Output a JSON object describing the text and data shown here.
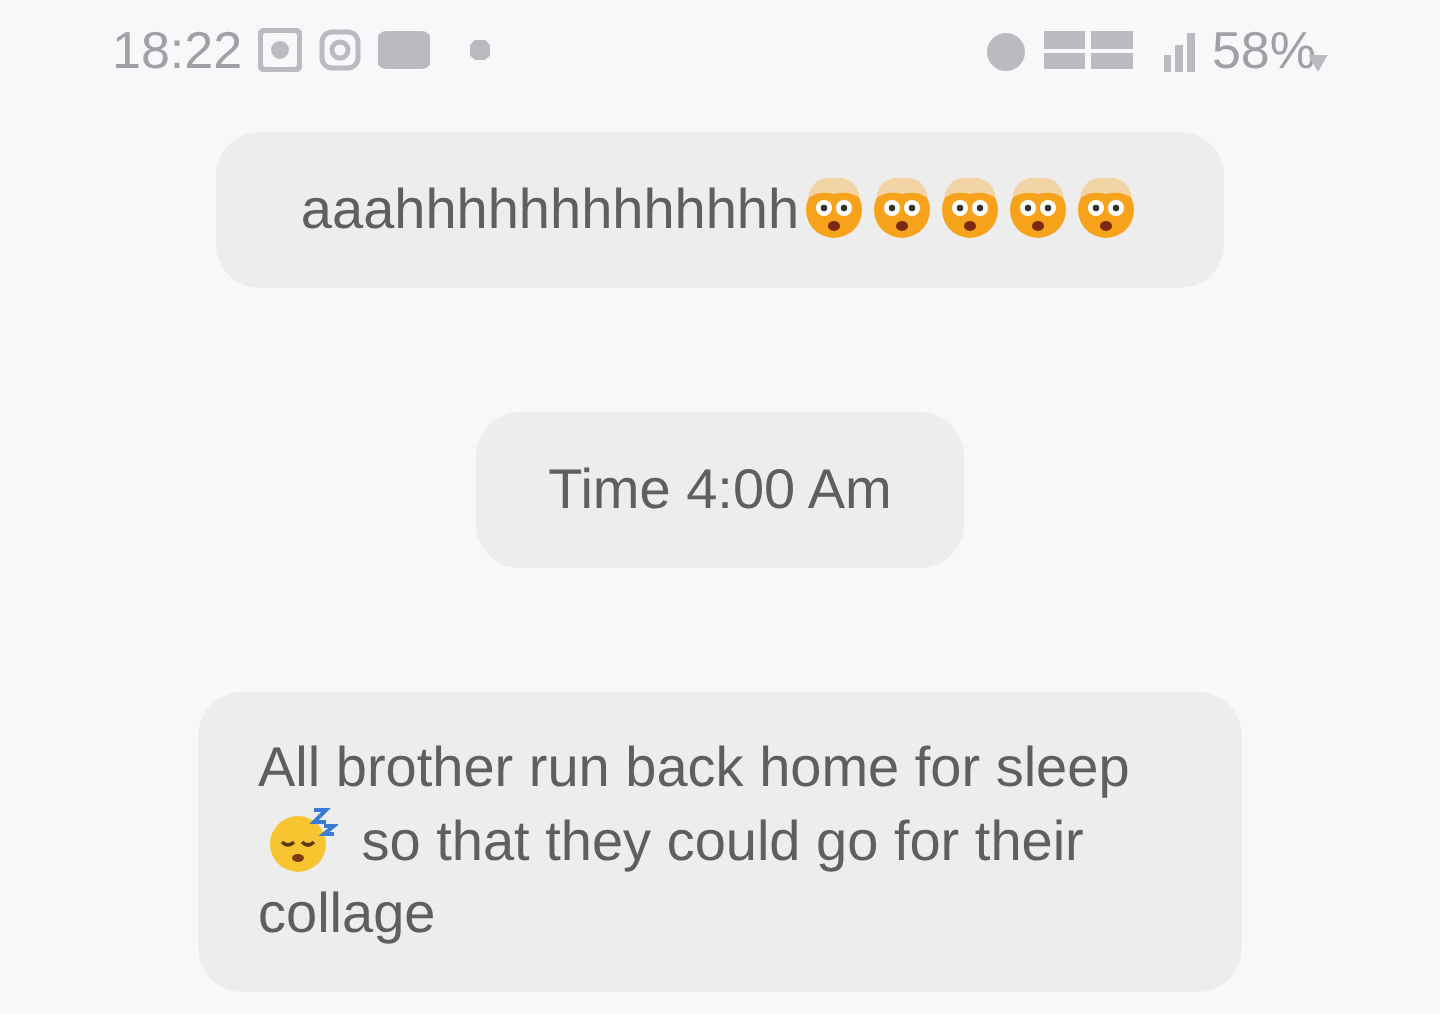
{
  "status_bar": {
    "time": "18:22",
    "battery": "58%"
  },
  "messages": [
    {
      "segments": [
        {
          "kind": "text",
          "text": "aaahhhhhhhhhhhhh"
        },
        {
          "kind": "shocked-emoji"
        },
        {
          "kind": "shocked-emoji"
        },
        {
          "kind": "shocked-emoji"
        },
        {
          "kind": "shocked-emoji"
        },
        {
          "kind": "shocked-emoji"
        }
      ]
    },
    {
      "segments": [
        {
          "kind": "text",
          "text": "Time 4:00 Am"
        }
      ]
    },
    {
      "segments": [
        {
          "kind": "text",
          "text": "All brother run back home for sleep"
        },
        {
          "kind": "sleepy-emoji"
        },
        {
          "kind": "text",
          "text": "so that they could go for their collage"
        }
      ]
    }
  ]
}
